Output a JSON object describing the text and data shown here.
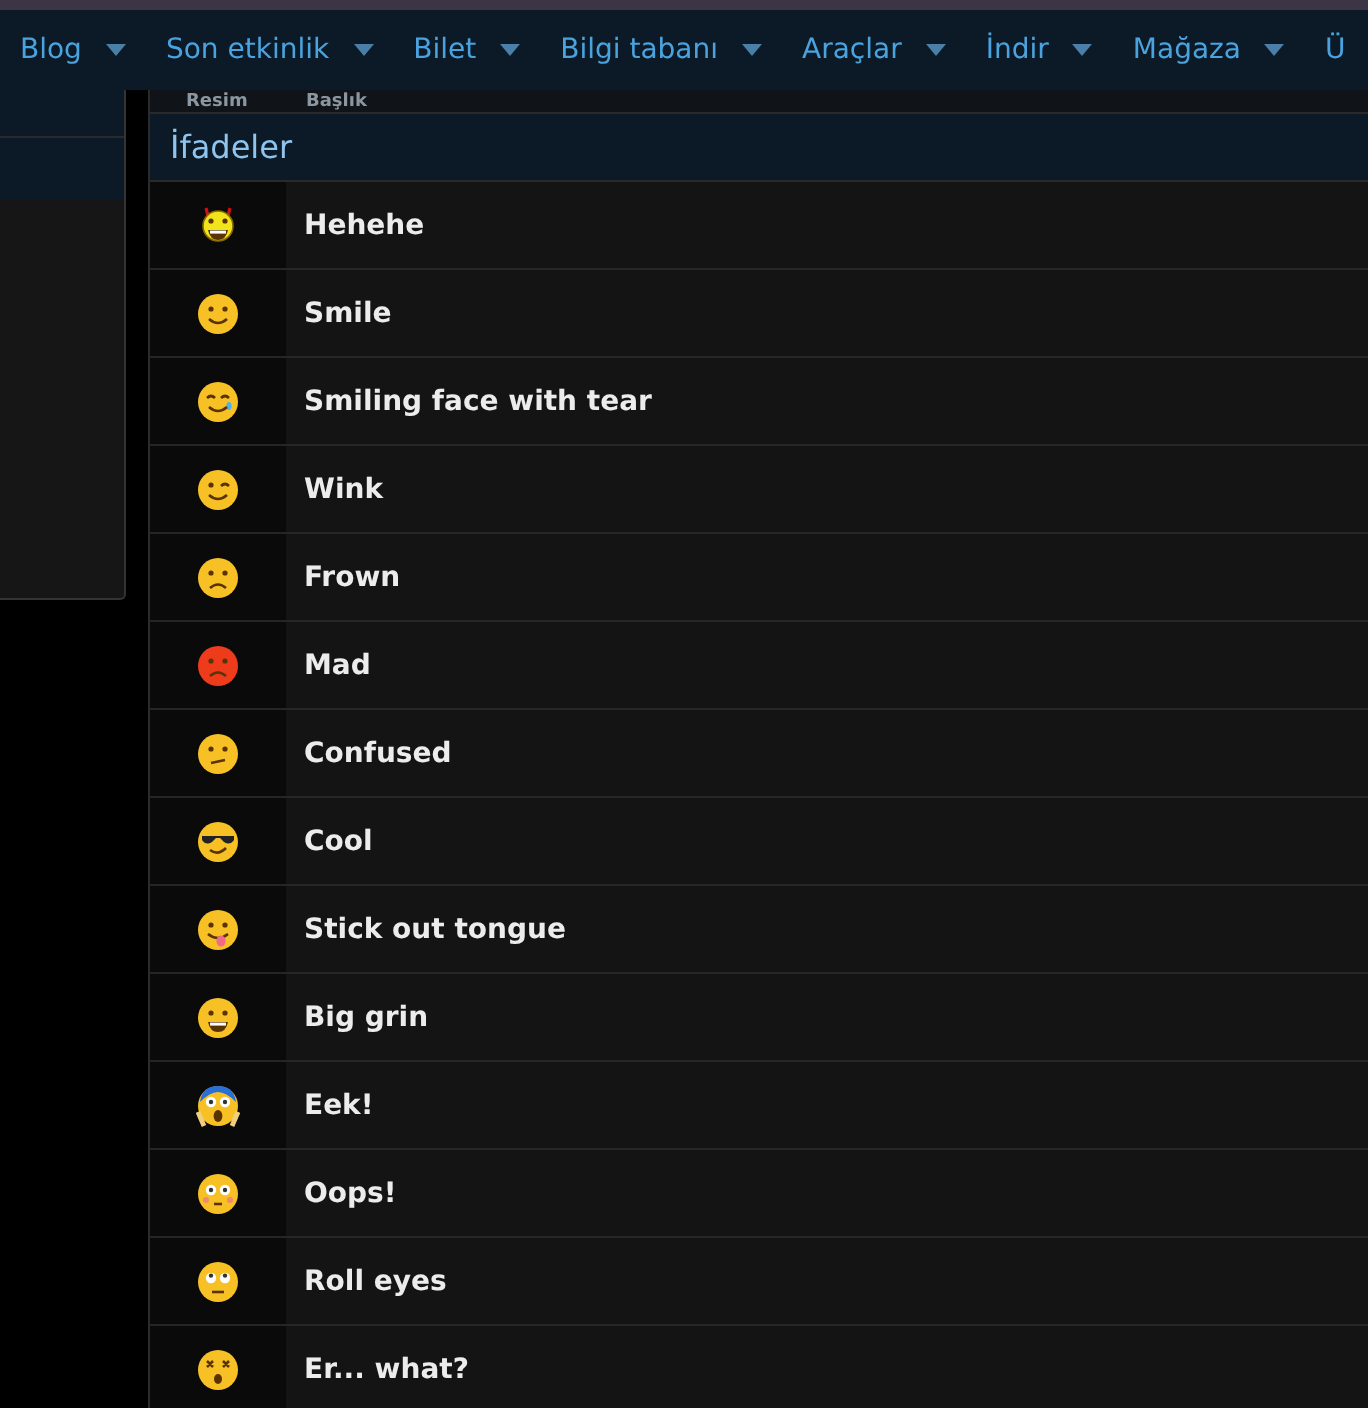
{
  "nav": {
    "items": [
      {
        "label": "Blog"
      },
      {
        "label": "Son etkinlik"
      },
      {
        "label": "Bilet"
      },
      {
        "label": "Bilgi tabanı"
      },
      {
        "label": "Araçlar"
      },
      {
        "label": "İndir"
      },
      {
        "label": "Mağaza"
      },
      {
        "label": "Ü"
      }
    ]
  },
  "table": {
    "columns": [
      "Resim",
      "Başlık"
    ],
    "category": "İfadeler",
    "rows": [
      {
        "title": "Hehehe"
      },
      {
        "title": "Smile"
      },
      {
        "title": "Smiling face with tear"
      },
      {
        "title": "Wink"
      },
      {
        "title": "Frown"
      },
      {
        "title": "Mad"
      },
      {
        "title": "Confused"
      },
      {
        "title": "Cool"
      },
      {
        "title": "Stick out tongue"
      },
      {
        "title": "Big grin"
      },
      {
        "title": "Eek!"
      },
      {
        "title": "Oops!"
      },
      {
        "title": "Roll eyes"
      },
      {
        "title": "Er... what?"
      }
    ]
  }
}
